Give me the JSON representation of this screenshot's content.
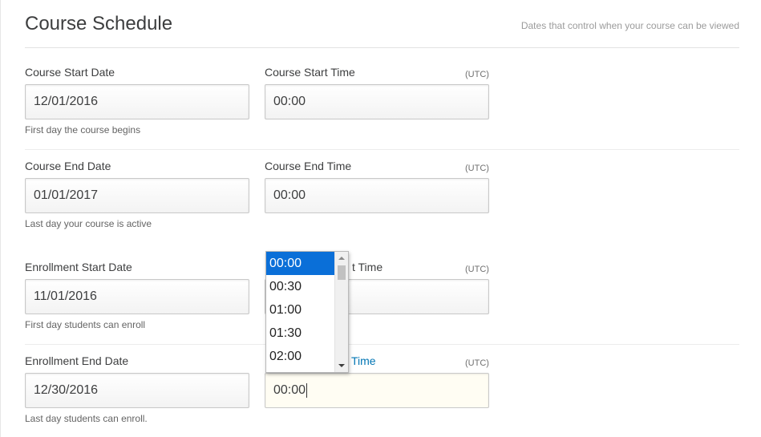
{
  "header": {
    "title": "Course Schedule",
    "subtitle": "Dates that control when your course can be viewed"
  },
  "rows": [
    {
      "date_label": "Course Start Date",
      "date_value": "12/01/2016",
      "date_help": "First day the course begins",
      "time_label": "Course Start Time",
      "time_zone": "(UTC)",
      "time_value": "00:00"
    },
    {
      "date_label": "Course End Date",
      "date_value": "01/01/2017",
      "date_help": "Last day your course is active",
      "time_label": "Course End Time",
      "time_zone": "(UTC)",
      "time_value": "00:00"
    },
    {
      "date_label": "Enrollment Start Date",
      "date_value": "11/01/2016",
      "date_help": "First day students can enroll",
      "time_label": "t Time",
      "time_zone": "(UTC)",
      "time_value": ""
    },
    {
      "date_label": "Enrollment End Date",
      "date_value": "12/30/2016",
      "date_help": "Last day students can enroll.",
      "time_label": "Time",
      "time_zone": "(UTC)",
      "time_value": "00:00"
    }
  ],
  "time_dropdown": {
    "selected": "00:00",
    "options": [
      "00:00",
      "00:30",
      "01:00",
      "01:30",
      "02:00"
    ]
  },
  "colors": {
    "accent": "#0075b4",
    "selection": "#0a6fd8",
    "active_field_bg": "#fffdf3"
  }
}
